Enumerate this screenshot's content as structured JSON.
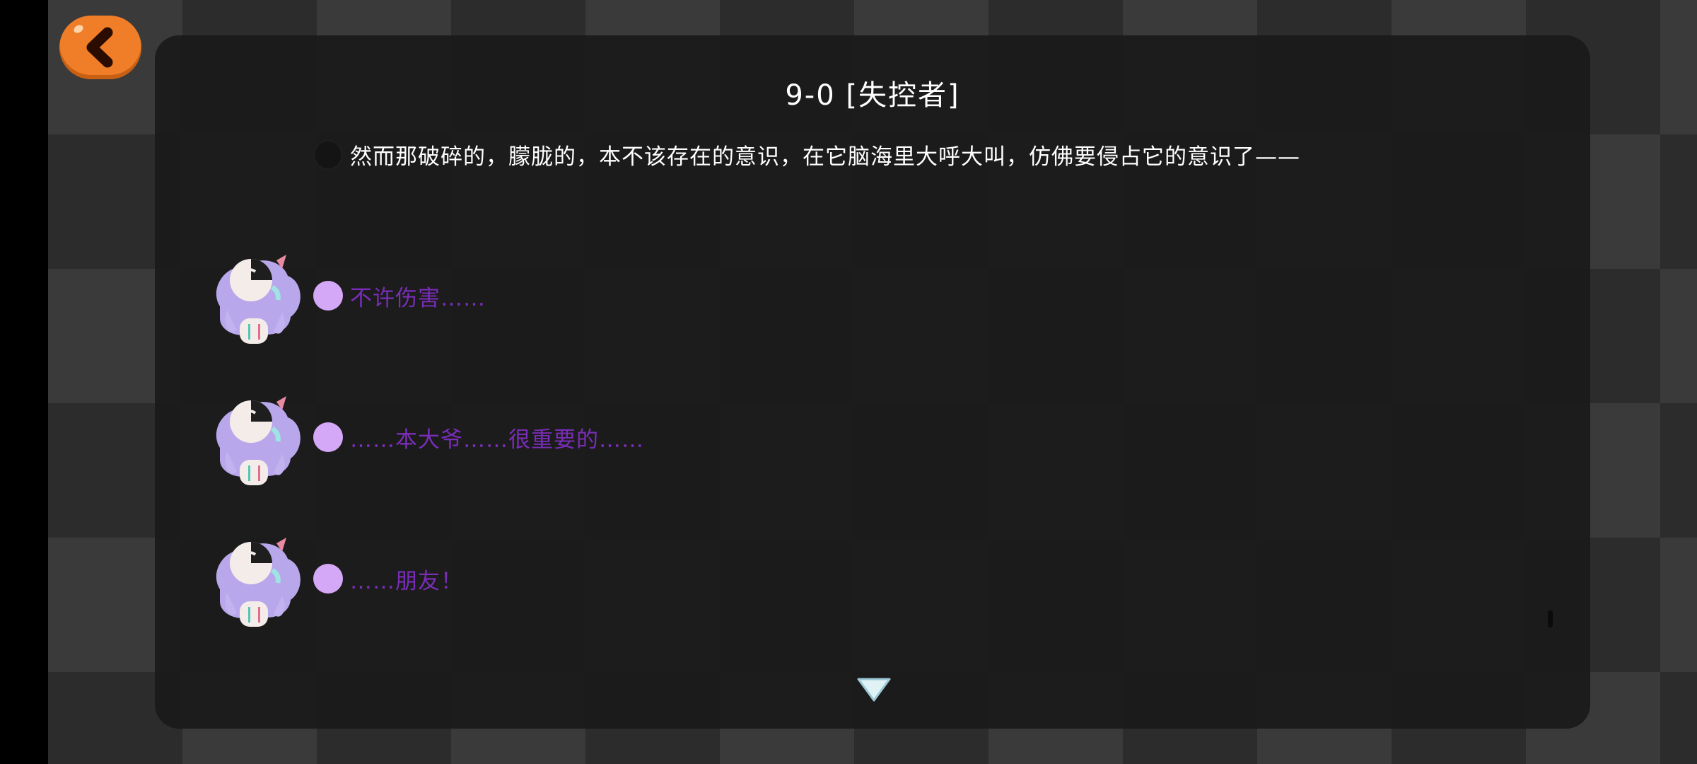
{
  "dialog": {
    "title": "9-0 [失控者]",
    "narration": "然而那破碎的，朦胧的，本不该存在的意识，在它脑海里大呼大叫，仿佛要侵占它的意识了——",
    "lines": [
      {
        "text": "不许伤害……"
      },
      {
        "text": "……本大爷……很重要的……"
      },
      {
        "text": "……朋友！"
      }
    ]
  },
  "icons": {
    "back": "chevron-left-icon",
    "continue": "triangle-down-icon"
  },
  "colors": {
    "back_button": "#f07d27",
    "panel": "#1a1a1a",
    "speaker_dot": "#d4a7f7",
    "speaker_text": "#7a2db8",
    "narration_text": "#ffffff"
  }
}
